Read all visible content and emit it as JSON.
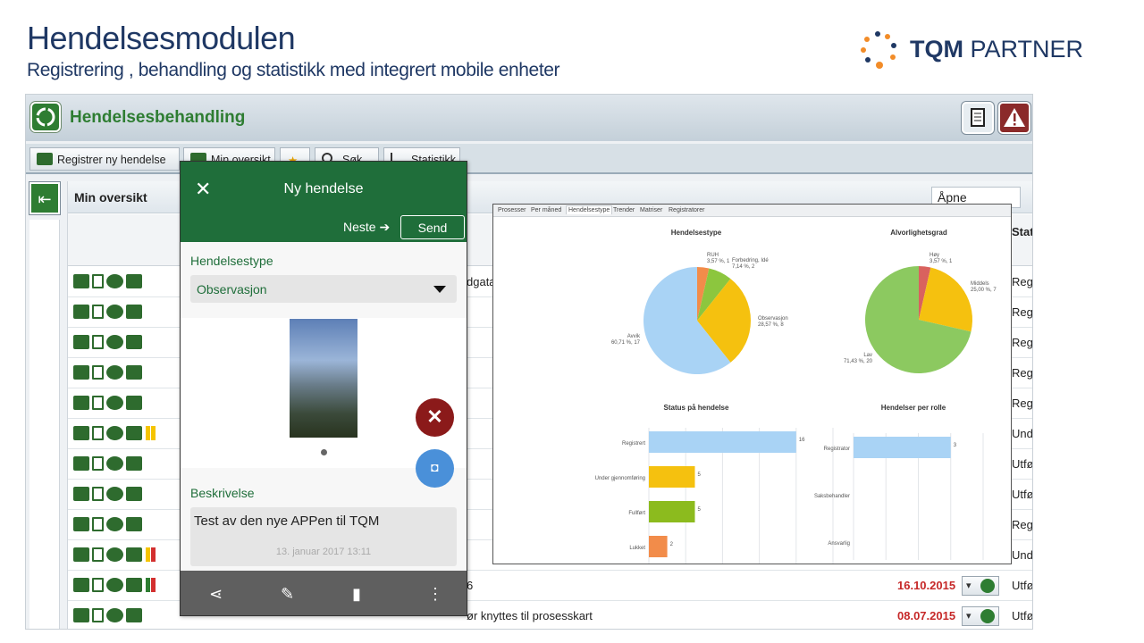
{
  "slide": {
    "title": "Hendelsesmodulen",
    "subtitle": "Registrering , behandling  og statistikk med integrert  mobile enheter",
    "logo_bold": "TQM",
    "logo_rest": " PARTNER"
  },
  "app": {
    "title": "Hendelsesbehandling",
    "toolbar": {
      "register": "Registrer ny hendelse",
      "overview": "Min oversikt",
      "search": "Søk",
      "stats": "Statistikk"
    },
    "panel_title": "Min oversikt",
    "filter_value": "Åpne",
    "status_header": "Stat",
    "rows": [
      {
        "text": "dgata",
        "flags": [],
        "status": "Regi",
        "date": ""
      },
      {
        "text": "",
        "flags": [],
        "status": "Regi",
        "date": ""
      },
      {
        "text": "",
        "flags": [],
        "status": "Regi",
        "date": ""
      },
      {
        "text": "",
        "flags": [],
        "status": "Regi",
        "date": ""
      },
      {
        "text": "",
        "flags": [],
        "status": "Regi",
        "date": ""
      },
      {
        "text": "",
        "flags": [
          "#f5c400",
          "#f5c400"
        ],
        "status": "Unde",
        "date": ""
      },
      {
        "text": "",
        "flags": [],
        "status": "Utfø",
        "date": ""
      },
      {
        "text": "",
        "flags": [],
        "status": "Utfø",
        "date": ""
      },
      {
        "text": "",
        "flags": [],
        "status": "Regi",
        "date": ""
      },
      {
        "text": "",
        "flags": [
          "#f5c400",
          "#d32f2f"
        ],
        "status": "Unde",
        "date": ""
      },
      {
        "text": "6",
        "flags": [
          "#2e7d32",
          "#d32f2f"
        ],
        "status": "Utfø",
        "date": "16.10.2015"
      },
      {
        "text": "ør knyttes til prosesskart",
        "flags": [],
        "status": "Utfø",
        "date": "08.07.2015"
      }
    ]
  },
  "mobile": {
    "title": "Ny hendelse",
    "next": "Neste",
    "send": "Send",
    "type_label": "Hendelsestype",
    "type_value": "Observasjon",
    "desc_label": "Beskrivelse",
    "desc_value": "Test av den nye APPen til TQM",
    "desc_date": "13. januar 2017 13:11"
  },
  "stats": {
    "tabs": [
      "Prosesser",
      "Per måned",
      "Hendelsestype",
      "Trender",
      "Matriser",
      "Registratorer"
    ],
    "active_tab": "Hendelsestype",
    "charts_title": [
      "Hendelsestype",
      "Alvorlighetsgrad",
      "Status på hendelse",
      "Hendelser per rolle"
    ]
  },
  "chart_data": [
    {
      "type": "pie",
      "title": "Hendelsestype",
      "slices": [
        {
          "label": "RUH",
          "pct": 3.57,
          "count": 1,
          "color": "#f28c4a"
        },
        {
          "label": "Forbedring, Idé",
          "pct": 7.14,
          "count": 2,
          "color": "#8cc63e"
        },
        {
          "label": "Observasjon",
          "pct": 28.57,
          "count": 8,
          "color": "#f5c10f"
        },
        {
          "label": "Avvik",
          "pct": 60.71,
          "count": 17,
          "color": "#a9d3f5"
        }
      ],
      "labels_text": [
        "RUH\n3,57 %, 1",
        "Forbedring, Idé\n7,14 %, 2",
        "Observasjon\n28,57 %, 8",
        "Avvik\n60,71 %, 17"
      ]
    },
    {
      "type": "pie",
      "title": "Alvorlighetsgrad",
      "slices": [
        {
          "label": "Høy",
          "pct": 3.57,
          "count": 1,
          "color": "#d9625e"
        },
        {
          "label": "Middels",
          "pct": 25.0,
          "count": 7,
          "color": "#f5c10f"
        },
        {
          "label": "Lav",
          "pct": 71.43,
          "count": 20,
          "color": "#8cc960"
        }
      ],
      "labels_text": [
        "Høy\n3,57 %, 1",
        "Middels\n25,00 %, 7",
        "Lav\n71,43 %, 20"
      ]
    },
    {
      "type": "bar",
      "title": "Status på hendelse",
      "categories": [
        "Registrert",
        "Under gjennomføring",
        "Fullført",
        "Lukket"
      ],
      "values": [
        16,
        5,
        5,
        2
      ],
      "colors": [
        "#a9d3f5",
        "#f5c10f",
        "#8cbb1e",
        "#f28c4a"
      ],
      "xlim": [
        0,
        20
      ]
    },
    {
      "type": "bar",
      "title": "Hendelser per rolle",
      "categories": [
        "Registrator",
        "Saksbehandler",
        "Ansvarlig"
      ],
      "values": [
        3,
        0,
        0
      ],
      "colors": [
        "#a9d3f5",
        "#a9d3f5",
        "#a9d3f5"
      ],
      "xlim": [
        0,
        4
      ]
    }
  ]
}
